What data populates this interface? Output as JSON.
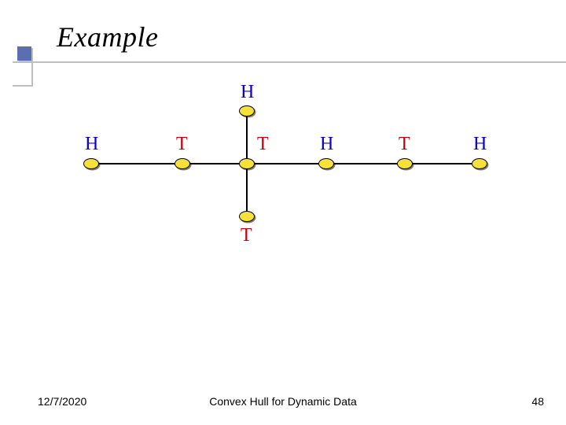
{
  "title": "Example",
  "footer": {
    "date": "12/7/2020",
    "center": "Convex Hull for Dynamic Data",
    "page": "48"
  },
  "labels": {
    "top": "H",
    "bottom": "T",
    "row": [
      "H",
      "T",
      "T",
      "H",
      "T",
      "H"
    ]
  }
}
